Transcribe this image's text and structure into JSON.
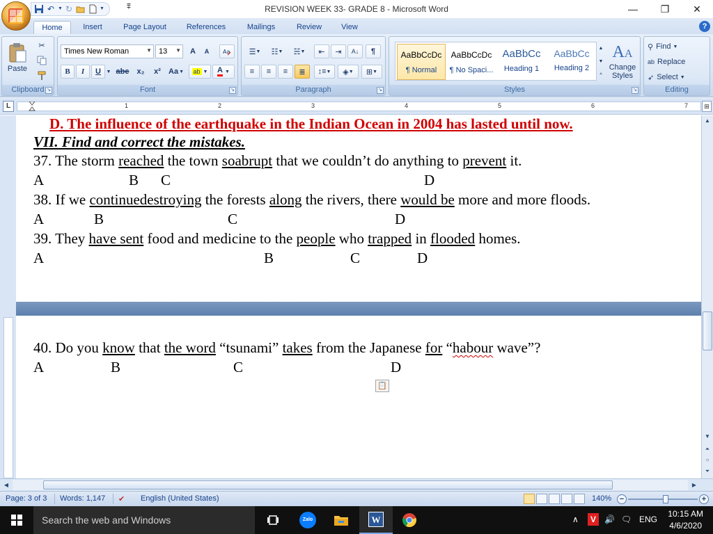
{
  "window": {
    "title": "REVISION WEEK 33- GRADE 8 - Microsoft Word",
    "minimize": "—",
    "restore": "❐",
    "close": "✕"
  },
  "tabs": [
    "Home",
    "Insert",
    "Page Layout",
    "References",
    "Mailings",
    "Review",
    "View"
  ],
  "ribbon": {
    "clipboard": {
      "label": "Clipboard",
      "paste": "Paste"
    },
    "font": {
      "label": "Font",
      "family": "Times New Roman",
      "size": "13",
      "bold": "B",
      "italic": "I",
      "underline": "U",
      "strike": "abe",
      "subscript": "x₂",
      "superscript": "x²",
      "change_case": "Aa",
      "grow": "A",
      "shrink": "A",
      "highlight_color": "#ffff00",
      "font_color": "#ff0000"
    },
    "paragraph": {
      "label": "Paragraph"
    },
    "styles": {
      "label": "Styles",
      "items": [
        {
          "sample": "AaBbCcDc",
          "name": "¶ Normal"
        },
        {
          "sample": "AaBbCcDc",
          "name": "¶ No Spaci..."
        },
        {
          "sample": "AaBbCc",
          "name": "Heading 1"
        },
        {
          "sample": "AaBbCc",
          "name": "Heading 2"
        }
      ],
      "change_styles": "Change Styles"
    },
    "editing": {
      "label": "Editing",
      "find": "Find",
      "replace": "Replace",
      "select": "Select"
    }
  },
  "ruler": {
    "tab_selector": "L",
    "numbers": [
      "1",
      "2",
      "3",
      "4",
      "5",
      "6",
      "7"
    ]
  },
  "document": {
    "line_d": "D. The influence of the earthquake in the Indian Ocean in 2004 has lasted until now.",
    "section_title": "VII. Find and correct the mistakes.",
    "q37": {
      "num": "37. The storm ",
      "a": "reached",
      "t1": " the town ",
      "b": "soabrupt",
      "t2": " that we couldn’t do anything to ",
      "d": "prevent",
      "t3": " it."
    },
    "q38": {
      "num": "38. If we ",
      "a": "continuedestroying",
      "t1": " the forests ",
      "b": "along",
      "t2": " the rivers, there ",
      "c": "would be",
      "t3": " more and more floods."
    },
    "q39": {
      "num": "39. They ",
      "a": "have sent",
      "t1": " food and medicine to the ",
      "b": "people",
      "t2": " who ",
      "c": "trapped",
      "t3": " in ",
      "d": "flooded",
      "t4": " homes."
    },
    "q40": {
      "num": "40. Do you ",
      "a": "know",
      "t1": " that ",
      "b": "the word",
      "t2": " “tsunami” ",
      "c": "takes",
      "t3": " from the Japanese ",
      "d": "for",
      "t4": " “",
      "e": "habour",
      "t5": " wave”?"
    },
    "labels": {
      "A": "A",
      "B": "B",
      "C": "C",
      "D": "D"
    }
  },
  "statusbar": {
    "page": "Page: 3 of 3",
    "words": "Words: 1,147",
    "language": "English (United States)",
    "zoom": "140%"
  },
  "taskbar": {
    "search_placeholder": "Search the web and Windows",
    "language": "ENG",
    "time": "10:15 AM",
    "date": "4/6/2020"
  }
}
